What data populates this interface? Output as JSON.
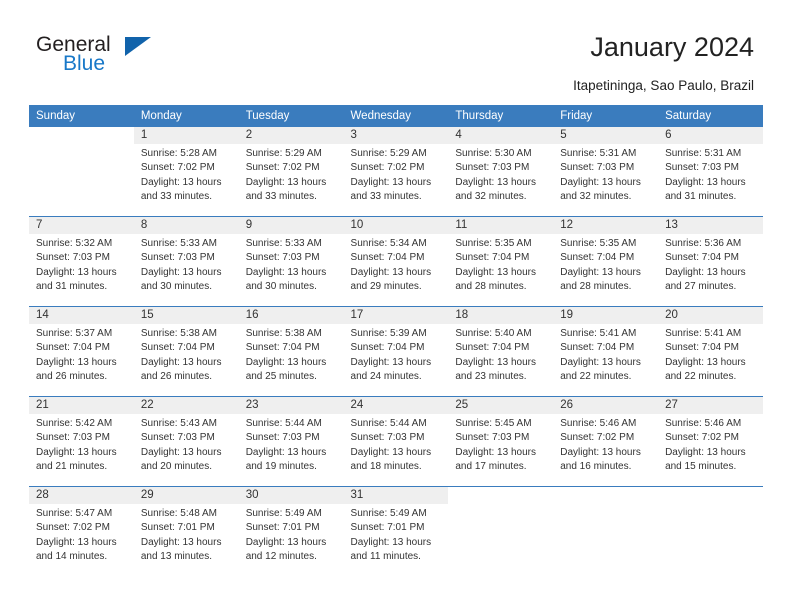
{
  "brand": {
    "name_top": "General",
    "name_bottom": "Blue",
    "accent_color": "#1163ab",
    "text_color": "#231f20"
  },
  "header": {
    "title": "January 2024",
    "subtitle": "Itapetininga, Sao Paulo, Brazil",
    "header_bg": "#3a7cbe",
    "header_text": "#ffffff",
    "daynum_bg": "#efefef"
  },
  "weekdays": [
    "Sunday",
    "Monday",
    "Tuesday",
    "Wednesday",
    "Thursday",
    "Friday",
    "Saturday"
  ],
  "labels": {
    "sunrise_prefix": "Sunrise:",
    "sunset_prefix": "Sunset:",
    "daylight_prefix": "Daylight:"
  },
  "weeks": [
    {
      "days": [
        {
          "num": "",
          "l1": "",
          "l2": "",
          "l3": "",
          "l4": ""
        },
        {
          "num": "1",
          "l1": "Sunrise: 5:28 AM",
          "l2": "Sunset: 7:02 PM",
          "l3": "Daylight: 13 hours",
          "l4": "and 33 minutes."
        },
        {
          "num": "2",
          "l1": "Sunrise: 5:29 AM",
          "l2": "Sunset: 7:02 PM",
          "l3": "Daylight: 13 hours",
          "l4": "and 33 minutes."
        },
        {
          "num": "3",
          "l1": "Sunrise: 5:29 AM",
          "l2": "Sunset: 7:02 PM",
          "l3": "Daylight: 13 hours",
          "l4": "and 33 minutes."
        },
        {
          "num": "4",
          "l1": "Sunrise: 5:30 AM",
          "l2": "Sunset: 7:03 PM",
          "l3": "Daylight: 13 hours",
          "l4": "and 32 minutes."
        },
        {
          "num": "5",
          "l1": "Sunrise: 5:31 AM",
          "l2": "Sunset: 7:03 PM",
          "l3": "Daylight: 13 hours",
          "l4": "and 32 minutes."
        },
        {
          "num": "6",
          "l1": "Sunrise: 5:31 AM",
          "l2": "Sunset: 7:03 PM",
          "l3": "Daylight: 13 hours",
          "l4": "and 31 minutes."
        }
      ]
    },
    {
      "days": [
        {
          "num": "7",
          "l1": "Sunrise: 5:32 AM",
          "l2": "Sunset: 7:03 PM",
          "l3": "Daylight: 13 hours",
          "l4": "and 31 minutes."
        },
        {
          "num": "8",
          "l1": "Sunrise: 5:33 AM",
          "l2": "Sunset: 7:03 PM",
          "l3": "Daylight: 13 hours",
          "l4": "and 30 minutes."
        },
        {
          "num": "9",
          "l1": "Sunrise: 5:33 AM",
          "l2": "Sunset: 7:03 PM",
          "l3": "Daylight: 13 hours",
          "l4": "and 30 minutes."
        },
        {
          "num": "10",
          "l1": "Sunrise: 5:34 AM",
          "l2": "Sunset: 7:04 PM",
          "l3": "Daylight: 13 hours",
          "l4": "and 29 minutes."
        },
        {
          "num": "11",
          "l1": "Sunrise: 5:35 AM",
          "l2": "Sunset: 7:04 PM",
          "l3": "Daylight: 13 hours",
          "l4": "and 28 minutes."
        },
        {
          "num": "12",
          "l1": "Sunrise: 5:35 AM",
          "l2": "Sunset: 7:04 PM",
          "l3": "Daylight: 13 hours",
          "l4": "and 28 minutes."
        },
        {
          "num": "13",
          "l1": "Sunrise: 5:36 AM",
          "l2": "Sunset: 7:04 PM",
          "l3": "Daylight: 13 hours",
          "l4": "and 27 minutes."
        }
      ]
    },
    {
      "days": [
        {
          "num": "14",
          "l1": "Sunrise: 5:37 AM",
          "l2": "Sunset: 7:04 PM",
          "l3": "Daylight: 13 hours",
          "l4": "and 26 minutes."
        },
        {
          "num": "15",
          "l1": "Sunrise: 5:38 AM",
          "l2": "Sunset: 7:04 PM",
          "l3": "Daylight: 13 hours",
          "l4": "and 26 minutes."
        },
        {
          "num": "16",
          "l1": "Sunrise: 5:38 AM",
          "l2": "Sunset: 7:04 PM",
          "l3": "Daylight: 13 hours",
          "l4": "and 25 minutes."
        },
        {
          "num": "17",
          "l1": "Sunrise: 5:39 AM",
          "l2": "Sunset: 7:04 PM",
          "l3": "Daylight: 13 hours",
          "l4": "and 24 minutes."
        },
        {
          "num": "18",
          "l1": "Sunrise: 5:40 AM",
          "l2": "Sunset: 7:04 PM",
          "l3": "Daylight: 13 hours",
          "l4": "and 23 minutes."
        },
        {
          "num": "19",
          "l1": "Sunrise: 5:41 AM",
          "l2": "Sunset: 7:04 PM",
          "l3": "Daylight: 13 hours",
          "l4": "and 22 minutes."
        },
        {
          "num": "20",
          "l1": "Sunrise: 5:41 AM",
          "l2": "Sunset: 7:04 PM",
          "l3": "Daylight: 13 hours",
          "l4": "and 22 minutes."
        }
      ]
    },
    {
      "days": [
        {
          "num": "21",
          "l1": "Sunrise: 5:42 AM",
          "l2": "Sunset: 7:03 PM",
          "l3": "Daylight: 13 hours",
          "l4": "and 21 minutes."
        },
        {
          "num": "22",
          "l1": "Sunrise: 5:43 AM",
          "l2": "Sunset: 7:03 PM",
          "l3": "Daylight: 13 hours",
          "l4": "and 20 minutes."
        },
        {
          "num": "23",
          "l1": "Sunrise: 5:44 AM",
          "l2": "Sunset: 7:03 PM",
          "l3": "Daylight: 13 hours",
          "l4": "and 19 minutes."
        },
        {
          "num": "24",
          "l1": "Sunrise: 5:44 AM",
          "l2": "Sunset: 7:03 PM",
          "l3": "Daylight: 13 hours",
          "l4": "and 18 minutes."
        },
        {
          "num": "25",
          "l1": "Sunrise: 5:45 AM",
          "l2": "Sunset: 7:03 PM",
          "l3": "Daylight: 13 hours",
          "l4": "and 17 minutes."
        },
        {
          "num": "26",
          "l1": "Sunrise: 5:46 AM",
          "l2": "Sunset: 7:02 PM",
          "l3": "Daylight: 13 hours",
          "l4": "and 16 minutes."
        },
        {
          "num": "27",
          "l1": "Sunrise: 5:46 AM",
          "l2": "Sunset: 7:02 PM",
          "l3": "Daylight: 13 hours",
          "l4": "and 15 minutes."
        }
      ]
    },
    {
      "days": [
        {
          "num": "28",
          "l1": "Sunrise: 5:47 AM",
          "l2": "Sunset: 7:02 PM",
          "l3": "Daylight: 13 hours",
          "l4": "and 14 minutes."
        },
        {
          "num": "29",
          "l1": "Sunrise: 5:48 AM",
          "l2": "Sunset: 7:01 PM",
          "l3": "Daylight: 13 hours",
          "l4": "and 13 minutes."
        },
        {
          "num": "30",
          "l1": "Sunrise: 5:49 AM",
          "l2": "Sunset: 7:01 PM",
          "l3": "Daylight: 13 hours",
          "l4": "and 12 minutes."
        },
        {
          "num": "31",
          "l1": "Sunrise: 5:49 AM",
          "l2": "Sunset: 7:01 PM",
          "l3": "Daylight: 13 hours",
          "l4": "and 11 minutes."
        },
        {
          "num": "",
          "l1": "",
          "l2": "",
          "l3": "",
          "l4": ""
        },
        {
          "num": "",
          "l1": "",
          "l2": "",
          "l3": "",
          "l4": ""
        },
        {
          "num": "",
          "l1": "",
          "l2": "",
          "l3": "",
          "l4": ""
        }
      ]
    }
  ]
}
